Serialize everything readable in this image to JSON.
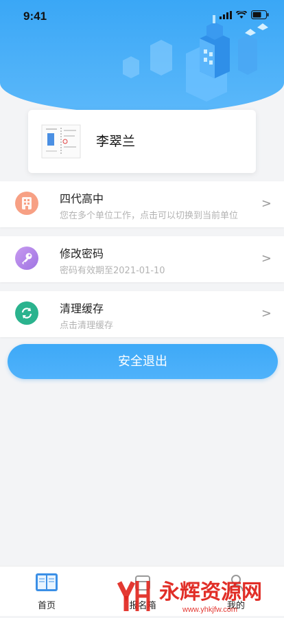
{
  "status_bar": {
    "time": "9:41"
  },
  "profile": {
    "name": "李翠兰"
  },
  "items": [
    {
      "title": "四代高中",
      "subtitle": "您在多个单位工作，点击可以切换到当前单位",
      "icon": "building-icon",
      "color": "#f59a7c"
    },
    {
      "title": "修改密码",
      "subtitle": "密码有效期至2021-01-10",
      "icon": "key-icon",
      "color": "#b78ae8"
    },
    {
      "title": "清理缓存",
      "subtitle": "点击清理缓存",
      "icon": "refresh-icon",
      "color": "#2bb38e"
    }
  ],
  "chevron": ">",
  "logout_label": "安全退出",
  "tabs": [
    {
      "label": "首页",
      "icon": "book-icon"
    },
    {
      "label": "报名箱",
      "icon": "mailbox-icon"
    },
    {
      "label": "我的",
      "icon": "user-icon"
    }
  ],
  "watermark": {
    "text": "永辉资源网",
    "url": "www.yhkjfw.com"
  },
  "colors": {
    "header": "#3aa7f6",
    "button": "#43acf8"
  }
}
